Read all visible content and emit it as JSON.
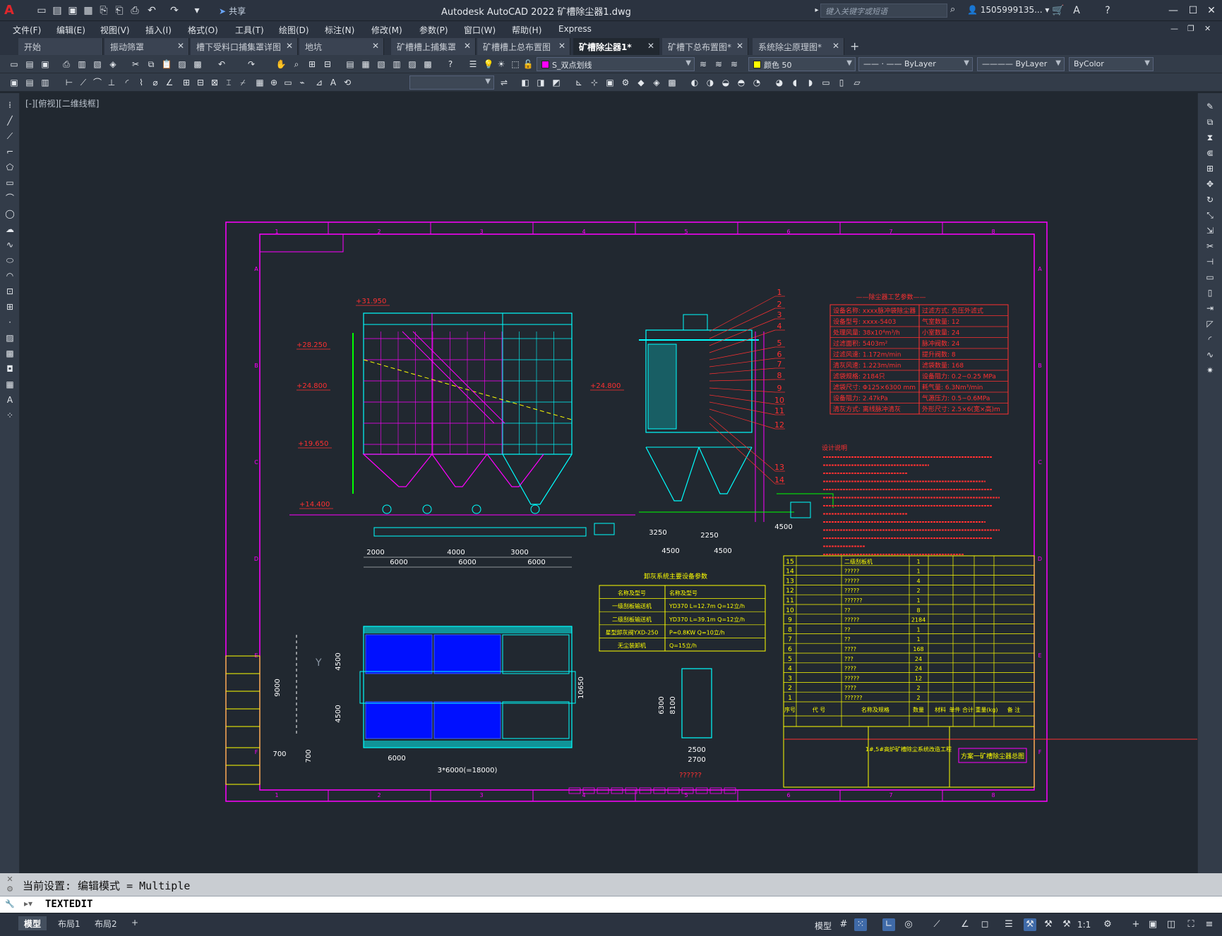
{
  "app": {
    "logo": "A",
    "share_label": "共享",
    "title": "Autodesk AutoCAD 2022    矿槽除尘器1.dwg",
    "search_placeholder": "键入关键字或短语",
    "user": "1505999135...",
    "minimize": "—",
    "restore": "☐",
    "close": "✕"
  },
  "menu": [
    "文件(F)",
    "编辑(E)",
    "视图(V)",
    "插入(I)",
    "格式(O)",
    "工具(T)",
    "绘图(D)",
    "标注(N)",
    "修改(M)",
    "参数(P)",
    "窗口(W)",
    "帮助(H)",
    "Express"
  ],
  "tabs": [
    {
      "label": "开始",
      "active": false
    },
    {
      "label": "振动筛罩",
      "active": false
    },
    {
      "label": "槽下受料口捕集罩详图",
      "active": false
    },
    {
      "label": "地坑",
      "active": false
    },
    {
      "label": "矿槽槽上捕集罩",
      "active": false
    },
    {
      "label": "矿槽槽上总布置图",
      "active": false
    },
    {
      "label": "矿槽除尘器1*",
      "active": true
    },
    {
      "label": "矿槽下总布置图*",
      "active": false
    },
    {
      "label": "系统除尘原理图*",
      "active": false
    }
  ],
  "toolbar": {
    "layer": "S_双点划线",
    "layer_color": "#ff00ff",
    "color": "颜色 50",
    "color_swatch": "#ffff00",
    "linetype": "ByLayer",
    "lineweight": "ByLayer",
    "plotstyle": "ByColor"
  },
  "viewport_label": "[-][俯视][二维线框]",
  "command": {
    "history": "当前设置: 编辑模式 = Multiple",
    "current": "TEXTEDIT"
  },
  "status": {
    "layouts": [
      "模型",
      "布局1",
      "布局2"
    ],
    "model_label": "模型",
    "scale": "1:1"
  },
  "drawing": {
    "title_red": "——除尘器工艺参数——",
    "param_table": [
      [
        "设备名称: xxxx脉冲袋除尘器",
        "过滤方式: 负压外滤式"
      ],
      [
        "设备型号: xxxx-5403",
        "气室数量: 12"
      ],
      [
        "处理风量: 38x10⁴m³/h",
        "小室数量: 24"
      ],
      [
        "过滤面积: 5403m²",
        "脉冲阀数: 24"
      ],
      [
        "过滤风速: 1.172m/min",
        "提升阀数: 8"
      ],
      [
        "清灰风速: 1.223m/min",
        "滤袋数量: 168"
      ],
      [
        "滤袋规格: 2184只",
        "设备阻力: 0.2~0.25 MPa"
      ],
      [
        "滤袋尺寸: Φ125×6300 mm",
        "耗气量: 6.3Nm³/min"
      ],
      [
        "设备阻力: 2.47kPa",
        "气源压力: 0.5~0.6MPa"
      ],
      [
        "清灰方式: 离线脉冲清灰",
        "外形尺寸: 2.5×6(宽×高)m"
      ]
    ],
    "notes_title": "设计说明",
    "equipment_title": "卸灰系统主要设备参数",
    "equipment_rows": [
      [
        "名称及型号",
        "名称及型号"
      ],
      [
        "一级刮板输送机",
        "YD370  L=12.7m  Q=12立/h"
      ],
      [
        "二级刮板输送机",
        "YD370  L=39.1m  Q=12立/h"
      ],
      [
        "星型卸灰阀YXD-250",
        "P=0.8KW  Q=10立/h"
      ],
      [
        "无尘装卸机",
        "Q=15立/h"
      ]
    ],
    "elevations": [
      "+31.950",
      "+28.250",
      "+24.800",
      "+19.650",
      "+14.400",
      "+24.800"
    ],
    "dims_bottom": [
      "2000",
      "6000",
      "4000",
      "6000",
      "3000",
      "6000"
    ],
    "dims_right": [
      "3250",
      "2250",
      "4500",
      "4500",
      "4500"
    ],
    "plan_dims": [
      "6000",
      "3*6000(=18000)",
      "10650",
      "9000",
      "4500",
      "4500",
      "700",
      "700"
    ],
    "small_dims": [
      "6300",
      "8100",
      "2500",
      "2700",
      "??????"
    ],
    "bom_rows": [
      [
        "15",
        "二级刮板机",
        "1"
      ],
      [
        "14",
        "?????",
        "1"
      ],
      [
        "13",
        "?????",
        "4"
      ],
      [
        "12",
        "?????",
        "2"
      ],
      [
        "11",
        "??????",
        "1"
      ],
      [
        "10",
        "??",
        "8"
      ],
      [
        "9",
        "?????",
        "2184"
      ],
      [
        "8",
        "??",
        "1"
      ],
      [
        "7",
        "??",
        "1"
      ],
      [
        "6",
        "????",
        "168"
      ],
      [
        "5",
        "???",
        "24"
      ],
      [
        "4",
        "????",
        "24"
      ],
      [
        "3",
        "?????",
        "12"
      ],
      [
        "2",
        "????",
        "2"
      ],
      [
        "1",
        "??????",
        "2"
      ]
    ],
    "bom_header": [
      "序号",
      "代 号",
      "名称及规格",
      "数量",
      "材料",
      "单件 合计 重量(kg)",
      "备 注"
    ],
    "title_block_project": "1#,5#高炉矿槽除尘系统改造工程",
    "title_block_name": "方案一矿槽除尘器总图",
    "grid_top": [
      "1",
      "2",
      "3",
      "4",
      "5",
      "6",
      "7",
      "8"
    ],
    "grid_side": [
      "A",
      "B",
      "C",
      "D",
      "E",
      "F"
    ]
  }
}
